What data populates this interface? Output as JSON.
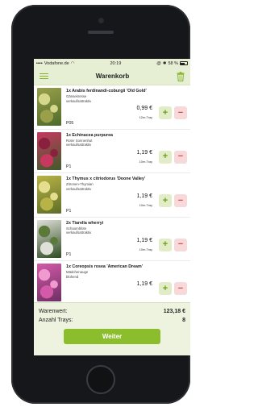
{
  "status": {
    "carrier": "Vodafone.de",
    "time": "20:19",
    "battery": "58 %"
  },
  "nav": {
    "title": "Warenkorb"
  },
  "items": [
    {
      "name": "1x Arabis ferdinandi-coburgii 'Old Gold'",
      "common": "Gänsekresse",
      "status": "verkaufsattraktiv",
      "code": "P05",
      "price": "0,99 €",
      "tray": "12er-Tray",
      "plus": "+",
      "minus": "−",
      "thumb_colors": [
        "#9aa04a",
        "#d6d78a",
        "#4d6a2a"
      ]
    },
    {
      "name": "1x Echinacea purpurea",
      "common": "Roter Sonnenhut",
      "status": "verkaufsattraktiv",
      "code": "P1",
      "price": "1,19 €",
      "tray": "10er-Tray",
      "plus": "+",
      "minus": "−",
      "thumb_colors": [
        "#c7385f",
        "#8a1f3e",
        "#3e5c2a"
      ]
    },
    {
      "name": "1x Thymus x citriodorus 'Doone Valley'",
      "common": "Zitronen-Thymian",
      "status": "verkaufsattraktiv",
      "code": "P1",
      "price": "1,19 €",
      "tray": "10er-Tray",
      "plus": "+",
      "minus": "−",
      "thumb_colors": [
        "#b8b346",
        "#e5de8e",
        "#5e6d28"
      ]
    },
    {
      "name": "2x Tiarella wherryi",
      "common": "Schaumblüte",
      "status": "verkaufsattraktiv",
      "code": "P1",
      "price": "1,19 €",
      "tray": "10er-Tray",
      "plus": "+",
      "minus": "−",
      "thumb_colors": [
        "#dfe0d8",
        "#5b7a3a",
        "#2e4a22"
      ]
    },
    {
      "name": "1x Coreopsis rosea 'American Dream'",
      "common": "Mädchenauge",
      "status": "blühend",
      "code": "",
      "price": "1,19 €",
      "tray": "",
      "plus": "+",
      "minus": "−",
      "thumb_colors": [
        "#d35aa8",
        "#f09ad0",
        "#6d2f63"
      ]
    }
  ],
  "summary": {
    "warenwert_label": "Warenwert:",
    "warenwert_value": "123,18 €",
    "trays_label": "Anzahl Trays:",
    "trays_value": "8",
    "button": "Weiter"
  },
  "colors": {
    "accent_green": "#8cbd2d",
    "header_bg": "#e6eed3",
    "minus_bg": "#f8d9da",
    "minus_fg": "#d54a50"
  }
}
